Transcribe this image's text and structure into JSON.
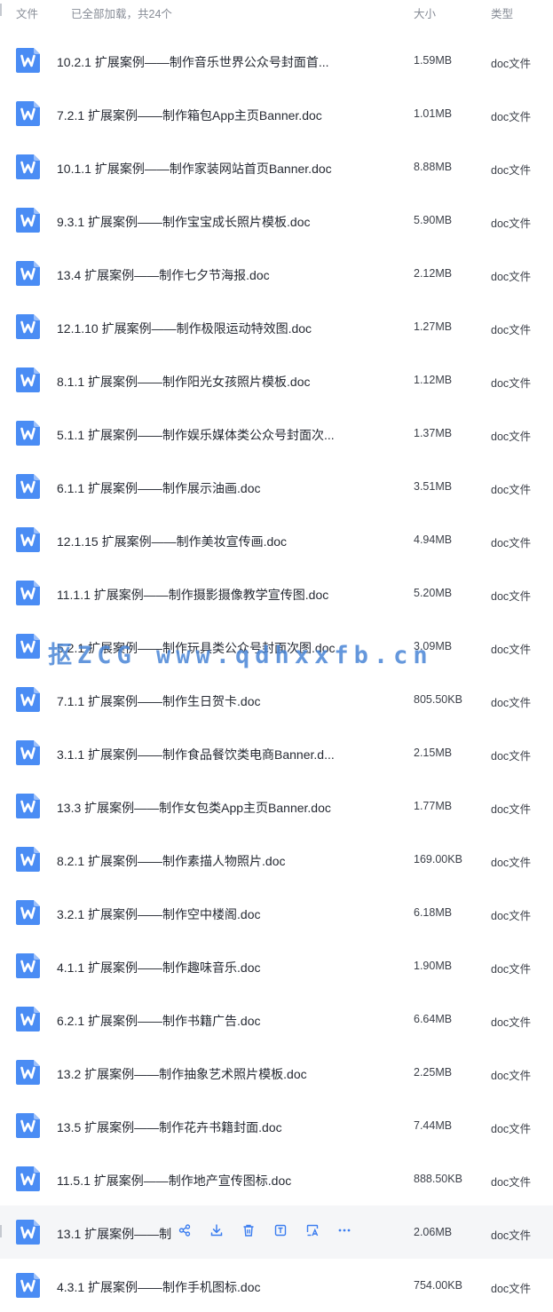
{
  "header": {
    "col_file": "文件",
    "loaded_text": "已全部加载，共24个",
    "col_size": "大小",
    "col_type": "类型"
  },
  "files": [
    {
      "name": "10.2.1 扩展案例——制作音乐世界公众号封面首...",
      "size": "1.59MB",
      "type": "doc文件"
    },
    {
      "name": "7.2.1 扩展案例——制作箱包App主页Banner.doc",
      "size": "1.01MB",
      "type": "doc文件"
    },
    {
      "name": "10.1.1 扩展案例——制作家装网站首页Banner.doc",
      "size": "8.88MB",
      "type": "doc文件"
    },
    {
      "name": "9.3.1 扩展案例——制作宝宝成长照片模板.doc",
      "size": "5.90MB",
      "type": "doc文件"
    },
    {
      "name": "13.4 扩展案例——制作七夕节海报.doc",
      "size": "2.12MB",
      "type": "doc文件"
    },
    {
      "name": "12.1.10 扩展案例——制作极限运动特效图.doc",
      "size": "1.27MB",
      "type": "doc文件"
    },
    {
      "name": "8.1.1 扩展案例——制作阳光女孩照片模板.doc",
      "size": "1.12MB",
      "type": "doc文件"
    },
    {
      "name": "5.1.1 扩展案例——制作娱乐媒体类公众号封面次...",
      "size": "1.37MB",
      "type": "doc文件"
    },
    {
      "name": "6.1.1 扩展案例——制作展示油画.doc",
      "size": "3.51MB",
      "type": "doc文件"
    },
    {
      "name": "12.1.15 扩展案例——制作美妆宣传画.doc",
      "size": "4.94MB",
      "type": "doc文件"
    },
    {
      "name": "11.1.1 扩展案例——制作摄影摄像教学宣传图.doc",
      "size": "5.20MB",
      "type": "doc文件"
    },
    {
      "name": "5.2.1 扩展案例——制作玩具类公众号封面次图.doc",
      "size": "3.09MB",
      "type": "doc文件"
    },
    {
      "name": "7.1.1 扩展案例——制作生日贺卡.doc",
      "size": "805.50KB",
      "type": "doc文件"
    },
    {
      "name": "3.1.1 扩展案例——制作食品餐饮类电商Banner.d...",
      "size": "2.15MB",
      "type": "doc文件"
    },
    {
      "name": "13.3 扩展案例——制作女包类App主页Banner.doc",
      "size": "1.77MB",
      "type": "doc文件"
    },
    {
      "name": "8.2.1 扩展案例——制作素描人物照片.doc",
      "size": "169.00KB",
      "type": "doc文件"
    },
    {
      "name": "3.2.1 扩展案例——制作空中楼阁.doc",
      "size": "6.18MB",
      "type": "doc文件"
    },
    {
      "name": "4.1.1 扩展案例——制作趣味音乐.doc",
      "size": "1.90MB",
      "type": "doc文件"
    },
    {
      "name": "6.2.1 扩展案例——制作书籍广告.doc",
      "size": "6.64MB",
      "type": "doc文件"
    },
    {
      "name": "13.2 扩展案例——制作抽象艺术照片模板.doc",
      "size": "2.25MB",
      "type": "doc文件"
    },
    {
      "name": "13.5 扩展案例——制作花卉书籍封面.doc",
      "size": "7.44MB",
      "type": "doc文件"
    },
    {
      "name": "11.5.1 扩展案例——制作地产宣传图标.doc",
      "size": "888.50KB",
      "type": "doc文件"
    },
    {
      "name": "13.1 扩展案例——制",
      "size": "2.06MB",
      "type": "doc文件",
      "hovered": true
    },
    {
      "name": "4.3.1 扩展案例——制作手机图标.doc",
      "size": "754.00KB",
      "type": "doc文件"
    }
  ],
  "hover_actions": [
    "share-icon",
    "download-icon",
    "delete-icon",
    "text-extract-icon",
    "image-text-icon",
    "more-icon"
  ],
  "watermark": "抠ZCG www.qdhxxfb.cn",
  "colors": {
    "icon_blue": "#4a8cf4",
    "hover_row": "#f5f6f8",
    "action_blue": "#3b7df0"
  }
}
